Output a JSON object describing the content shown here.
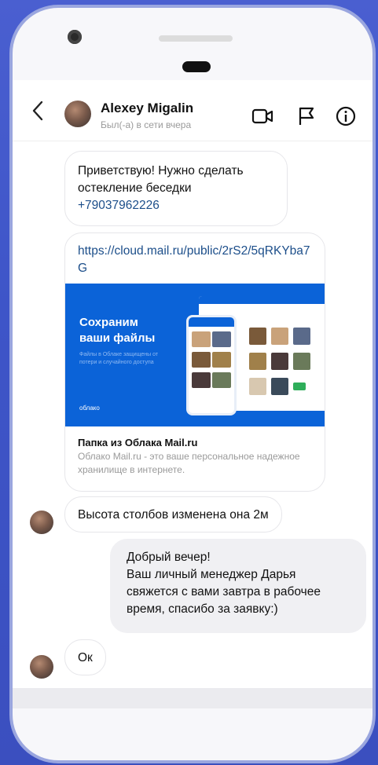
{
  "header": {
    "back_icon": "chevron-left-icon",
    "contact_name": "Alexey Migalin",
    "status": "Был(-а) в сети вчера",
    "icons": [
      "video-icon",
      "flag-icon",
      "info-icon"
    ]
  },
  "messages": [
    {
      "text": "Приветствую! Нужно сделать остекление беседки",
      "phone": "+79037962226"
    },
    {
      "url": "https://cloud.mail.ru/public/2rS2/5qRKYba7G",
      "preview": {
        "title": "Сохраним ваши файлы",
        "subtitle": "Файлы в Облаке защищены от потери и случайного доступа",
        "logo": "облако"
      },
      "card_title": "Папка из Облака Mail.ru",
      "card_description": "Облако Mail.ru - это ваше персональное надежное хранилище в интернете."
    },
    {
      "text": "Высота столбов изменена она 2м"
    },
    {
      "text_lines": [
        "Добрый вечер!",
        "Ваш личный менеджер Дарья",
        "свяжется с вами завтра в рабочее",
        "время, спасибо за заявку:)"
      ]
    },
    {
      "text": "Ок"
    }
  ],
  "colors": {
    "background": "#3e55c8",
    "link": "#1c4e8a",
    "preview_blue": "#0b63d8",
    "outgoing_bubble": "#f0f0f3"
  }
}
